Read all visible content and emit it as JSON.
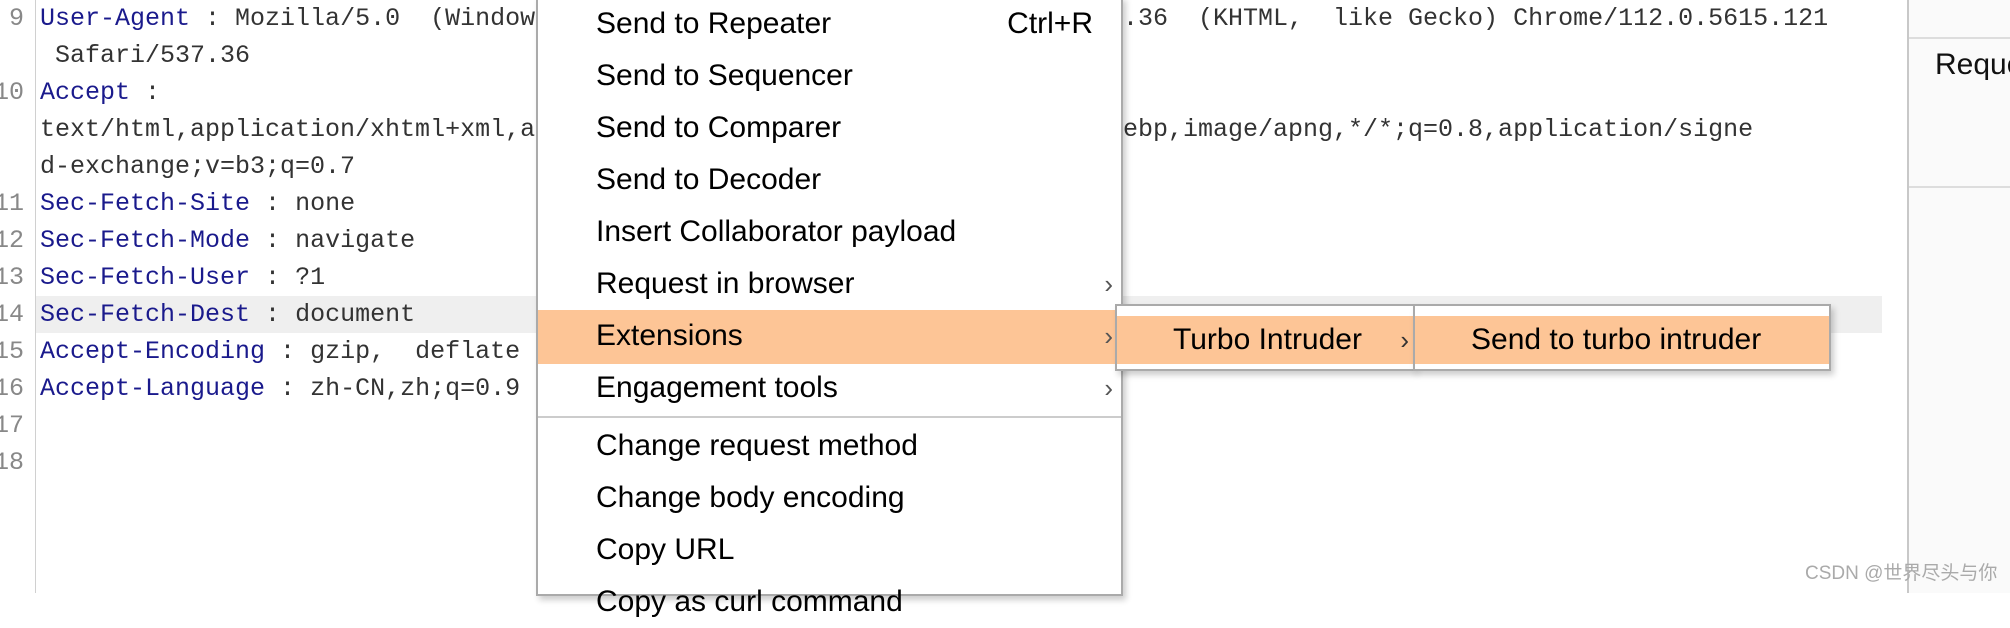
{
  "editor": {
    "lines": [
      {
        "num": "9",
        "key": "User-Agent",
        "sep": " : ",
        "value": "Mozilla/5.0  (Windows",
        "right": ".36  (KHTML,  like Gecko) Chrome/112.0.5615.121"
      },
      {
        "num": "",
        "cont": " Safari/537.36"
      },
      {
        "num": "10",
        "key": "Accept",
        "sep": " :",
        "value": ""
      },
      {
        "num": "",
        "cont": "text/html,application/xhtml+xml,a",
        "right": "ebp,image/apng,*/*;q=0.8,application/signe"
      },
      {
        "num": "",
        "cont": "d-exchange;v=b3;q=0.7"
      },
      {
        "num": "11",
        "key": "Sec-Fetch-Site",
        "sep": " : ",
        "value": "none"
      },
      {
        "num": "12",
        "key": "Sec-Fetch-Mode",
        "sep": " : ",
        "value": "navigate"
      },
      {
        "num": "13",
        "key": "Sec-Fetch-User",
        "sep": " : ",
        "value": "?1"
      },
      {
        "num": "14",
        "key": "Sec-Fetch-Dest",
        "sep": " : ",
        "value": "document"
      },
      {
        "num": "15",
        "key": "Accept-Encoding",
        "sep": " : ",
        "value": "gzip,  deflate"
      },
      {
        "num": "16",
        "key": "Accept-Language",
        "sep": " : ",
        "value": "zh-CN,zh;q=0.9"
      },
      {
        "num": "17"
      },
      {
        "num": "18"
      }
    ],
    "highlighted_line": "14",
    "key_color": "#1a1a8c"
  },
  "right_panel": {
    "label": "Reque"
  },
  "context_menu": {
    "items": [
      {
        "label": "Send to Repeater",
        "shortcut": "Ctrl+R"
      },
      {
        "label": "Send to Sequencer"
      },
      {
        "label": "Send to Comparer"
      },
      {
        "label": "Send to Decoder"
      },
      {
        "label": "Insert Collaborator payload"
      },
      {
        "label": "Request in browser",
        "submenu": true
      },
      {
        "label": "Extensions",
        "submenu": true,
        "active": true
      },
      {
        "label": "Engagement tools",
        "submenu": true
      },
      {
        "label": "Change request method"
      },
      {
        "label": "Change body encoding"
      },
      {
        "label": "Copy URL"
      },
      {
        "label": "Copy as curl command"
      }
    ],
    "chevron": "›",
    "highlight_color": "#fdc596"
  },
  "submenu_extensions": {
    "label": "Turbo Intruder"
  },
  "submenu_turbo": {
    "label": "Send to turbo intruder"
  },
  "watermark": "CSDN @世界尽头与你"
}
